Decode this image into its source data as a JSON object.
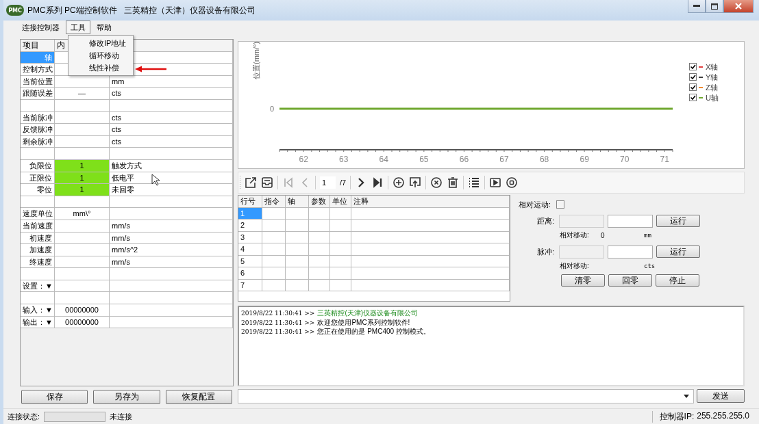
{
  "window": {
    "logo_text": "PMC",
    "title": "PMC系列 PC端控制软件   三英精控（天津）仪器设备有限公司"
  },
  "menu": [
    {
      "label": "连接控制器",
      "selected": false
    },
    {
      "label": "工具",
      "selected": true
    },
    {
      "label": "帮助",
      "selected": false
    }
  ],
  "dropdown": {
    "items": [
      "修改IP地址",
      "循环移动",
      "线性补偿"
    ]
  },
  "params": {
    "columns": [
      "项目",
      "内"
    ],
    "rows": [
      {
        "label": "轴",
        "kind": "right",
        "selected": true,
        "lit": false
      },
      {
        "label": "控制方式",
        "kind": "left",
        "selected": false,
        "lit": false
      },
      {
        "label": "当前位置",
        "unit": "mm",
        "kind": "left",
        "selected": false,
        "lit": false
      },
      {
        "label": "跟随误差",
        "value": "—",
        "unit": "cts",
        "kind": "left",
        "selected": false,
        "lit": false
      },
      {
        "kind": "left",
        "selected": false,
        "lit": false
      },
      {
        "label": "当前脉冲",
        "unit": "cts",
        "kind": "left",
        "selected": false,
        "lit": false
      },
      {
        "label": "反馈脉冲",
        "unit": "cts",
        "kind": "left",
        "selected": false,
        "lit": false
      },
      {
        "label": "剩余脉冲",
        "unit": "cts",
        "kind": "left",
        "selected": false,
        "lit": false
      },
      {
        "kind": "left",
        "selected": false,
        "lit": false
      },
      {
        "label": "负限位",
        "value": "1",
        "unit": "触发方式",
        "kind": "right",
        "selected": false,
        "lit": true
      },
      {
        "label": "正限位",
        "value": "1",
        "unit": "低电平",
        "kind": "right",
        "selected": false,
        "lit": true
      },
      {
        "label": "零位",
        "value": "1",
        "unit": "未回零",
        "kind": "right",
        "selected": false,
        "lit": true
      },
      {
        "kind": "left",
        "selected": false,
        "lit": false
      },
      {
        "label": "速度单位",
        "value": "mm\\°",
        "kind": "left",
        "selected": false,
        "lit": false
      },
      {
        "label": "当前速度",
        "unit": "mm/s",
        "kind": "left",
        "selected": false,
        "lit": false
      },
      {
        "label": "初速度",
        "unit": "mm/s",
        "kind": "right",
        "selected": false,
        "lit": false
      },
      {
        "label": "加速度",
        "unit": "mm/s^2",
        "kind": "right",
        "selected": false,
        "lit": false
      },
      {
        "label": "终速度",
        "unit": "mm/s",
        "kind": "right",
        "selected": false,
        "lit": false
      },
      {
        "kind": "left",
        "selected": false,
        "lit": false
      },
      {
        "label": "设置：▼",
        "kind": "left",
        "selected": false,
        "lit": false
      },
      {
        "kind": "left",
        "selected": false,
        "lit": false
      },
      {
        "label": "输入：▼",
        "value": "00000000",
        "kind": "left",
        "selected": false,
        "lit": false
      },
      {
        "label": "输出：▼",
        "value": "00000000",
        "kind": "left",
        "selected": false,
        "lit": false
      }
    ]
  },
  "left_buttons": [
    "保存",
    "另存为",
    "恢复配置"
  ],
  "chart": {
    "ylabel": "位置(mm/°)",
    "y_tick_labels": [
      "0"
    ],
    "x_tick_labels": [
      "62",
      "63",
      "64",
      "65",
      "66",
      "67",
      "68",
      "69",
      "70",
      "71"
    ],
    "legend": [
      {
        "name": "X轴",
        "color": "#e04040",
        "checked": true
      },
      {
        "name": "Y轴",
        "color": "#404040",
        "checked": true
      },
      {
        "name": "Z轴",
        "color": "#f08a30",
        "checked": true
      },
      {
        "name": "U轴",
        "color": "#70a830",
        "checked": true
      }
    ]
  },
  "toolbar": {
    "groups": [
      [
        {
          "kind": "export",
          "disabled": false
        },
        {
          "kind": "print",
          "disabled": false
        }
      ],
      [
        {
          "kind": "first",
          "disabled": true
        },
        {
          "kind": "prev",
          "disabled": true
        }
      ],
      [
        {
          "kind": "page",
          "value": "1",
          "total": "/7"
        }
      ],
      [
        {
          "kind": "next",
          "disabled": false
        },
        {
          "kind": "last",
          "disabled": false
        }
      ],
      [
        {
          "kind": "add",
          "disabled": false
        },
        {
          "kind": "upload",
          "disabled": false
        }
      ],
      [
        {
          "kind": "cancel",
          "disabled": false
        },
        {
          "kind": "trash",
          "disabled": false
        }
      ],
      [
        {
          "kind": "list",
          "disabled": false
        }
      ],
      [
        {
          "kind": "play",
          "disabled": false
        },
        {
          "kind": "stop",
          "disabled": false
        }
      ]
    ]
  },
  "program": {
    "columns": [
      "行号",
      "指令",
      "轴",
      "参数",
      "单位",
      "注释"
    ],
    "rows": [
      {
        "number": "1",
        "selected": true
      },
      {
        "number": "2",
        "selected": false
      },
      {
        "number": "3",
        "selected": false
      },
      {
        "number": "4",
        "selected": false
      },
      {
        "number": "5",
        "selected": false
      },
      {
        "number": "6",
        "selected": false
      },
      {
        "number": "7",
        "selected": false
      }
    ]
  },
  "motion": {
    "relative": {
      "label": "相对运动:",
      "checked": false
    },
    "rows": [
      {
        "label": "距离:",
        "fields": [
          {
            "disabled": true
          },
          {
            "disabled": false
          }
        ],
        "button": "运行",
        "note_label": "相对移动:",
        "note_value": "0",
        "note_unit": "mm"
      },
      {
        "label": "脉冲:",
        "fields": [
          {
            "disabled": true
          },
          {
            "disabled": false
          }
        ],
        "button": "运行",
        "note_label": "相对移动:",
        "note_unit": "cts"
      }
    ],
    "buttons": [
      "清零",
      "回零",
      "停止"
    ]
  },
  "log": [
    {
      "time": "2019/8/22 11:30:41 >>",
      "text": "三英精控(天津)仪器设备有限公司",
      "kind": "brand"
    },
    {
      "time": "2019/8/22 11:30:41 >>",
      "text": "欢迎您使用PMC系列控制软件!",
      "kind": "plain"
    },
    {
      "time": "2019/8/22 11:30:41 >>",
      "text": "您正在使用的是 PMC400 控制模式。",
      "kind": "plain"
    }
  ],
  "command": {
    "button": "发送"
  },
  "status": {
    "label": "连接状态:",
    "level": 0,
    "state": "未连接",
    "ip_label": "控制器IP:",
    "ip": "255.255.255.0"
  }
}
